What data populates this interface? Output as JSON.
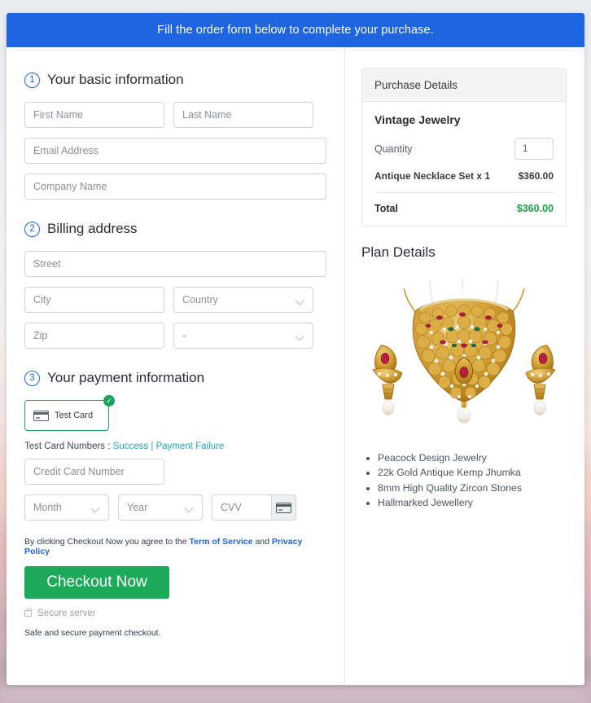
{
  "banner": {
    "text": "Fill the order form below to complete your purchase."
  },
  "sections": {
    "basic": {
      "num": "1",
      "title": "Your basic information"
    },
    "billing": {
      "num": "2",
      "title": "Billing address"
    },
    "payment": {
      "num": "3",
      "title": "Your payment information"
    }
  },
  "fields": {
    "first_name": "First Name",
    "last_name": "Last Name",
    "email": "Email Address",
    "company": "Company Name",
    "street": "Street",
    "city": "City",
    "country": "Country",
    "zip": "Zip",
    "state": "-",
    "credit_card": "Credit Card Number",
    "month": "Month",
    "year": "Year",
    "cvv": "CVV"
  },
  "payment": {
    "test_card_label": "Test  Card",
    "check_glyph": "✓",
    "test_numbers_label": "Test Card Numbers :",
    "success_link": "Success",
    "separator": "|",
    "failure_link": "Payment Failure"
  },
  "terms": {
    "prefix": "By clicking Checkout Now you agree to the",
    "tos": "Term of Service",
    "conjunction": "and",
    "privacy": "Privacy Policy"
  },
  "checkout": {
    "button_label": "Checkout Now"
  },
  "secure": {
    "label": "Secure server",
    "note": "Safe and secure payment checkout."
  },
  "purchase": {
    "header": "Purchase Details",
    "product_name": "Vintage Jewelry",
    "quantity_label": "Quantity",
    "quantity_value": "1",
    "line_item_label": "Antique Necklace Set x 1",
    "line_item_price": "$360.00",
    "total_label": "Total",
    "total_price": "$360.00"
  },
  "plan": {
    "title": "Plan Details",
    "features": [
      "Peacock Design Jewelry",
      "22k Gold Antique Kemp Jhumka",
      "8mm High Quality Zircon Stones",
      "Hallmarked Jewellery"
    ]
  },
  "colors": {
    "banner_blue": "#1f64e0",
    "accent_blue": "#1f64e0",
    "success_green": "#1aa35c",
    "button_green": "#1faa5b",
    "total_green": "#16a34a",
    "link_teal": "#1fa8bd"
  }
}
